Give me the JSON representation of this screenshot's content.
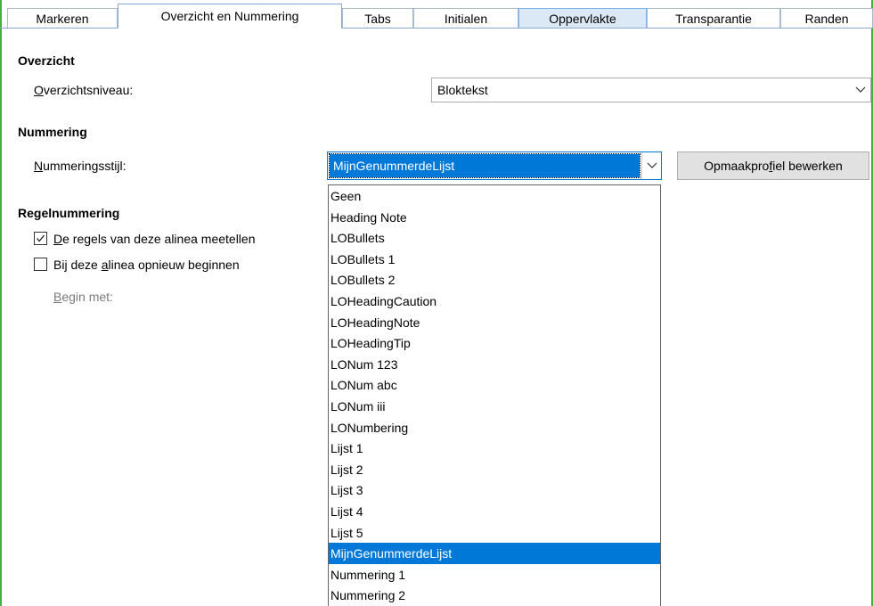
{
  "tabs": [
    {
      "label": "Markeren"
    },
    {
      "label": "Overzicht en Nummering"
    },
    {
      "label": "Tabs"
    },
    {
      "label": "Initialen"
    },
    {
      "label": "Oppervlakte"
    },
    {
      "label": "Transparantie"
    },
    {
      "label": "Randen"
    }
  ],
  "overzicht": {
    "title": "Overzicht",
    "level_label": "Overzichtsniveau:",
    "level_value": "Blokteksт"
  },
  "nummering": {
    "title": "Nummering",
    "style_label": "Nummeringsstijl:",
    "style_value": "MijnGenummerdeLijst",
    "edit_button": "Opmaakprofiel bewerken"
  },
  "regelnummering": {
    "title": "Regelnummering",
    "count_label": "De regels van deze alinea meetellen",
    "count_checked": true,
    "restart_label": "Bij deze alinea opnieuw beginnen",
    "restart_checked": false,
    "start_label": "Begin met:"
  },
  "dropdown_items": [
    "Geen",
    "Heading Note",
    "LOBullets",
    "LOBullets 1",
    "LOBullets 2",
    "LOHeadingCaution",
    "LOHeadingNote",
    "LOHeadingTip",
    "LONum 123",
    "LONum abc",
    "LONum iii",
    "LONumbering",
    "Lijst 1",
    "Lijst 2",
    "Lijst 3",
    "Lijst 4",
    "Lijst 5",
    "MijnGenummerdeLijst",
    "Nummering 1",
    "Nummering 2"
  ],
  "dropdown_selected": "MijnGenummerdeLijst",
  "colors": {
    "accent": "#0078d7",
    "dialog_border": "#43b044",
    "hover_tab": "#dbe8f6"
  },
  "icons": {
    "combo_arrow": "chevron-down-icon",
    "check": "check-icon"
  }
}
